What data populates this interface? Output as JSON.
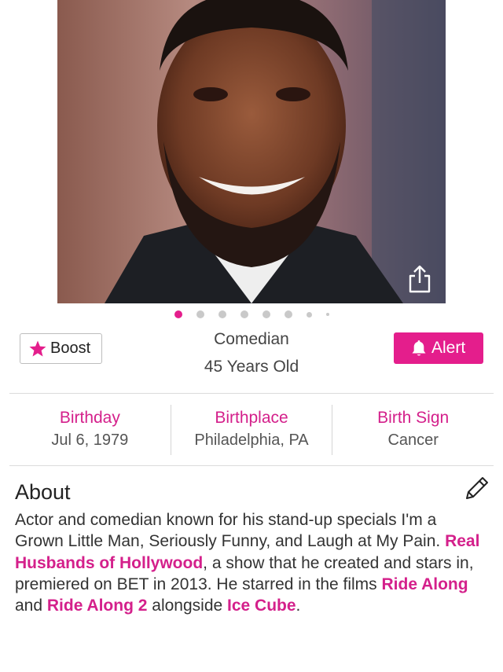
{
  "profile": {
    "occupation": "Comedian",
    "age": "45 Years Old"
  },
  "carousel": {
    "pages": 8,
    "active": 0
  },
  "buttons": {
    "boost_label": "Boost",
    "alert_label": "Alert"
  },
  "facts": {
    "birthday": {
      "label": "Birthday",
      "value": "Jul 6, 1979"
    },
    "birthplace": {
      "label": "Birthplace",
      "value": "Philadelphia, PA"
    },
    "birth_sign": {
      "label": "Birth Sign",
      "value": "Cancer"
    }
  },
  "about": {
    "title": "About",
    "segments": [
      {
        "text": "Actor and comedian known for his stand-up specials I'm a Grown Little Man, Seriously Funny, and Laugh at My Pain. ",
        "link": false
      },
      {
        "text": "Real Husbands of Hollywood",
        "link": true
      },
      {
        "text": ", a show that he created and stars in, premiered on BET in 2013. He starred in the films ",
        "link": false
      },
      {
        "text": "Ride Along",
        "link": true
      },
      {
        "text": " and ",
        "link": false
      },
      {
        "text": "Ride Along 2",
        "link": true
      },
      {
        "text": " alongside ",
        "link": false
      },
      {
        "text": "Ice Cube",
        "link": true
      },
      {
        "text": ".",
        "link": false
      }
    ]
  },
  "colors": {
    "accent": "#e41e8c",
    "link": "#d4208b"
  },
  "icons": {
    "share": "share-icon",
    "star": "star-icon",
    "bell": "bell-icon",
    "edit": "pencil-icon"
  }
}
